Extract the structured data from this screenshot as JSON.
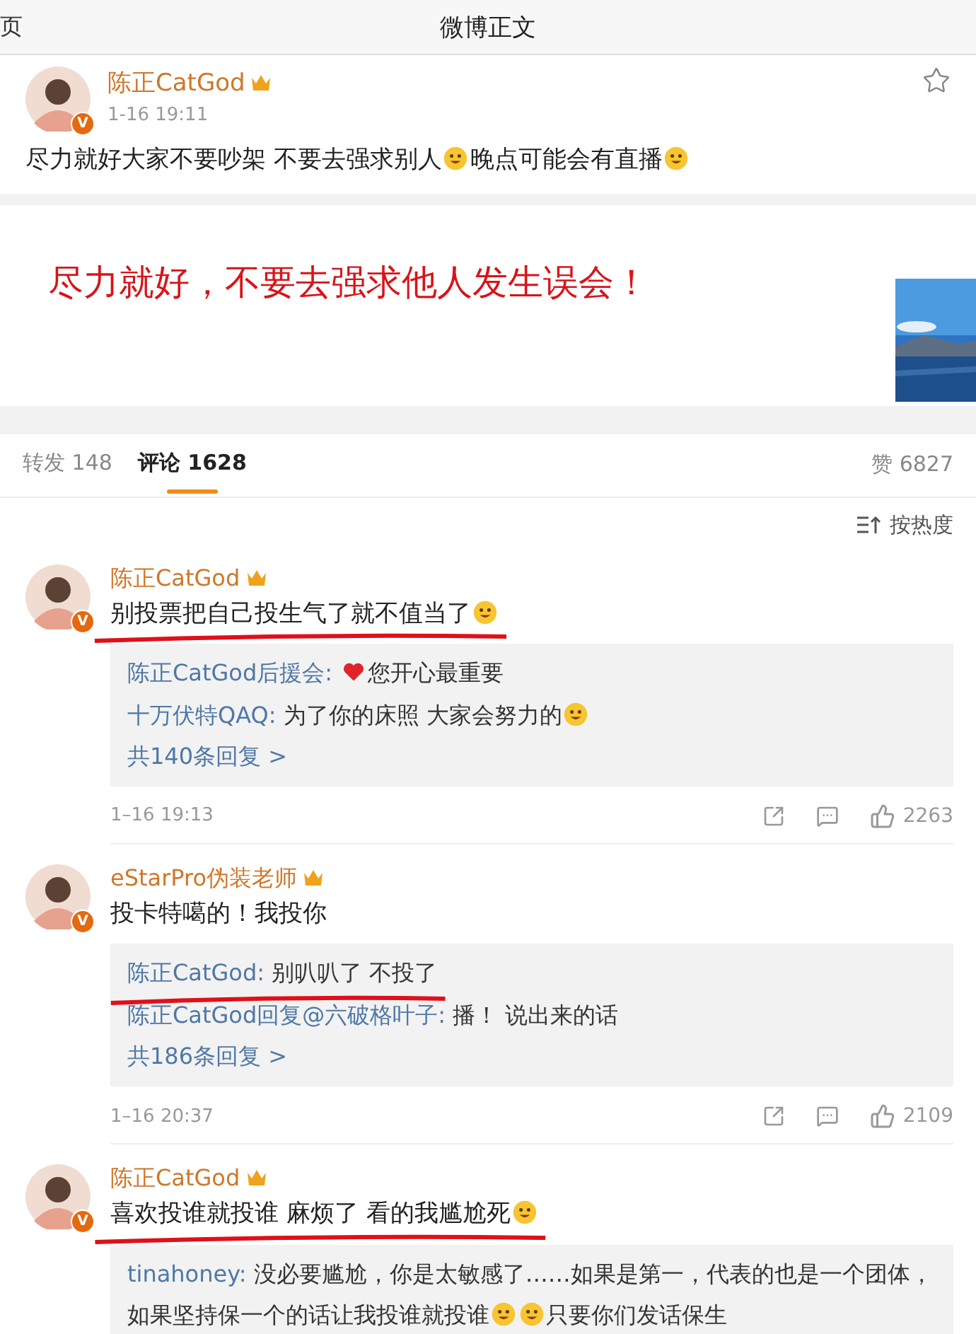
{
  "nav": {
    "back": "页",
    "title": "微博正文"
  },
  "post": {
    "author": "陈正CatGod",
    "badge": "V",
    "time": "1-16 19:11",
    "segments": [
      {
        "kind": "text",
        "text": "尽力就好大家不要吵架 不要去强求别人"
      },
      {
        "kind": "emoji"
      },
      {
        "kind": "text",
        "text": "晚点可能会有直播"
      },
      {
        "kind": "emoji"
      }
    ]
  },
  "image_card": {
    "caption": "尽力就好，不要去强求他人发生误会！"
  },
  "tabs": [
    {
      "label": "转发",
      "count": "148",
      "selected": false
    },
    {
      "label": "评论",
      "count": "1628",
      "selected": true
    }
  ],
  "likes": {
    "label": "赞",
    "count": "6827"
  },
  "sort": {
    "label": "按热度"
  },
  "comments": [
    {
      "author": "陈正CatGod",
      "badge": "V",
      "underlined": true,
      "segments": [
        {
          "kind": "text",
          "text": "别投票把自己投生气了就不值当了"
        },
        {
          "kind": "emoji"
        }
      ],
      "replies": [
        {
          "author": "陈正CatGod后援会:",
          "underlined": false,
          "segments": [
            {
              "kind": "heart"
            },
            {
              "kind": "text",
              "text": "您开心最重要"
            }
          ]
        },
        {
          "author": "十万伏特QAQ:",
          "underlined": false,
          "segments": [
            {
              "kind": "text",
              "text": "为了你的床照 大家会努力的"
            },
            {
              "kind": "emoji"
            }
          ]
        }
      ],
      "more": "共140条回复 >",
      "time": "1–16 19:13",
      "likes": "2263"
    },
    {
      "author": "eStarPro伪装老师",
      "badge": "V",
      "underlined": false,
      "segments": [
        {
          "kind": "text",
          "text": "投卡特噶的！我投你"
        }
      ],
      "replies": [
        {
          "author": "陈正CatGod:",
          "underlined": true,
          "segments": [
            {
              "kind": "text",
              "text": "别叭叭了 不投了"
            }
          ]
        },
        {
          "author": "陈正CatGod回复@六破格叶子:",
          "underlined": false,
          "segments": [
            {
              "kind": "text",
              "text": "播！ 说出来的话"
            }
          ]
        }
      ],
      "more": "共186条回复 >",
      "time": "1–16 20:37",
      "likes": "2109"
    },
    {
      "author": "陈正CatGod",
      "badge": "V",
      "underlined": true,
      "segments": [
        {
          "kind": "text",
          "text": "喜欢投谁就投谁 麻烦了 看的我尴尬死"
        },
        {
          "kind": "emoji"
        }
      ],
      "replies": [
        {
          "author": "tinahoney:",
          "underlined": false,
          "segments": [
            {
              "kind": "text",
              "text": "没必要尴尬，你是太敏感了……如果是第一，代表的也是一个团体，如果坚持保一个的话让我投谁就投谁"
            },
            {
              "kind": "emoji"
            },
            {
              "kind": "emoji"
            },
            {
              "kind": "text",
              "text": "只要你们发话保生"
            }
          ]
        }
      ]
    }
  ]
}
